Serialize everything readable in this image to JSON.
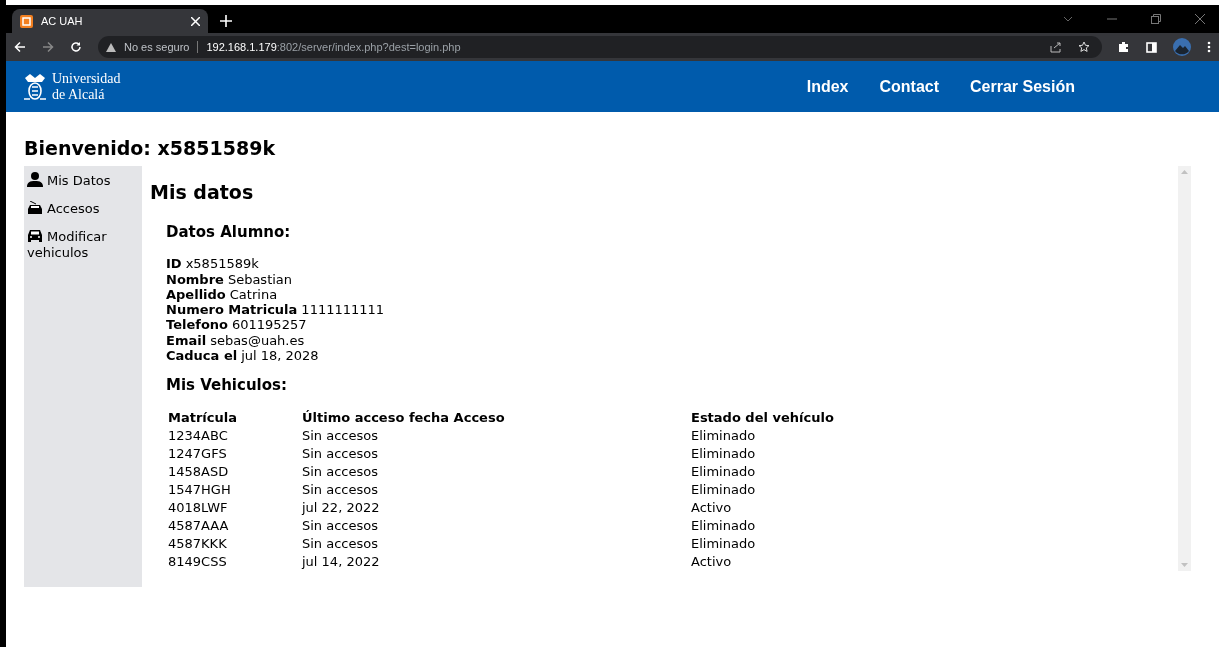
{
  "browser": {
    "tab_title": "AC UAH",
    "security": "No es seguro",
    "url_host": "192.168.1.179",
    "url_rest": ":802/server/index.php?dest=login.php"
  },
  "header": {
    "logo_line_1": "Universidad",
    "logo_line_2": "de Alcalá",
    "nav": [
      {
        "label": "Index"
      },
      {
        "label": "Contact"
      },
      {
        "label": "Cerrar Sesión"
      }
    ]
  },
  "welcome": "Bienvenido: x5851589k",
  "sidebar": {
    "items": [
      {
        "label": "Mis Datos",
        "kind": "user"
      },
      {
        "label": "Accesos",
        "kind": "access"
      },
      {
        "label": "Modificar vehiculos",
        "kind": "car"
      }
    ]
  },
  "main": {
    "title": "Mis datos",
    "student_heading": "Datos Alumno:",
    "fields": [
      {
        "label": "ID",
        "value": "x5851589k"
      },
      {
        "label": "Nombre",
        "value": "Sebastian"
      },
      {
        "label": "Apellido",
        "value": "Catrina"
      },
      {
        "label": "Numero Matricula",
        "value": "1111111111"
      },
      {
        "label": "Telefono",
        "value": "601195257"
      },
      {
        "label": "Email",
        "value": "sebas@uah.es"
      },
      {
        "label": "Caduca el",
        "value": "jul 18, 2028"
      }
    ],
    "vehicles_heading": "Mis Vehiculos:",
    "table": {
      "columns": [
        "Matrícula",
        "Último acceso fecha Acceso",
        "Estado del vehículo"
      ],
      "rows": [
        [
          "1234ABC",
          "Sin accesos",
          "Eliminado"
        ],
        [
          "1247GFS",
          "Sin accesos",
          "Eliminado"
        ],
        [
          "1458ASD",
          "Sin accesos",
          "Eliminado"
        ],
        [
          "1547HGH",
          "Sin accesos",
          "Eliminado"
        ],
        [
          "4018LWF",
          "jul 22, 2022",
          "Activo"
        ],
        [
          "4587AAA",
          "Sin accesos",
          "Eliminado"
        ],
        [
          "4587KKK",
          "Sin accesos",
          "Eliminado"
        ],
        [
          "8149CSS",
          "jul 14, 2022",
          "Activo"
        ]
      ]
    }
  }
}
